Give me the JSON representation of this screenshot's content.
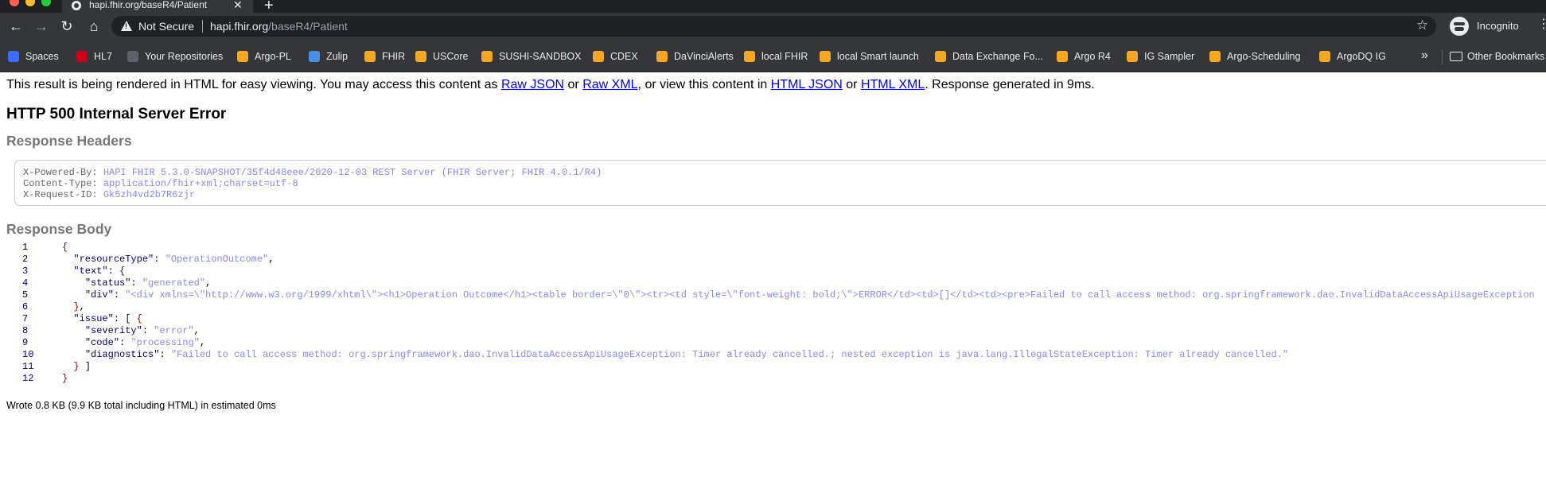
{
  "browser": {
    "tab_title": "hapi.fhir.org/baseR4/Patient",
    "tab_close": "✕",
    "new_tab": "+",
    "security_label": "Not Secure",
    "url_host": "hapi.fhir.org",
    "url_path": "/baseR4/Patient",
    "profile_label": "Incognito",
    "more_bookmarks": "»"
  },
  "bookmarks": [
    {
      "label": "Spaces",
      "icon": "spaces-icon",
      "color": "#3d6bff"
    },
    {
      "label": "HL7",
      "icon": "hl7-icon",
      "color": "#d0021b"
    },
    {
      "label": "Your Repositories",
      "icon": "github-icon",
      "color": "#5f6368"
    },
    {
      "label": "Argo-PL",
      "icon": "fhir-flame-icon",
      "color": "#f5a623"
    },
    {
      "label": "Zulip",
      "icon": "zulip-icon",
      "color": "#4a90e2"
    },
    {
      "label": "FHIR",
      "icon": "fhir-flame-icon",
      "color": "#f5a623"
    },
    {
      "label": "USCore",
      "icon": "fhir-flame-icon",
      "color": "#f5a623"
    },
    {
      "label": "SUSHI-SANDBOX",
      "icon": "fhir-flame-icon",
      "color": "#f5a623"
    },
    {
      "label": "CDEX",
      "icon": "fhir-flame-icon",
      "color": "#f5a623"
    },
    {
      "label": "DaVinciAlerts",
      "icon": "fhir-flame-icon",
      "color": "#f5a623"
    },
    {
      "label": "local FHIR",
      "icon": "fhir-flame-icon",
      "color": "#f5a623"
    },
    {
      "label": "local Smart launch",
      "icon": "fhir-flame-icon",
      "color": "#f5a623"
    },
    {
      "label": "Data Exchange Fo...",
      "icon": "fhir-flame-icon",
      "color": "#f5a623"
    },
    {
      "label": "Argo R4",
      "icon": "fhir-flame-icon",
      "color": "#f5a623"
    },
    {
      "label": "IG Sampler",
      "icon": "fhir-flame-icon",
      "color": "#f5a623"
    },
    {
      "label": "Argo-Scheduling",
      "icon": "fhir-flame-icon",
      "color": "#f5a623"
    },
    {
      "label": "ArgoDQ IG",
      "icon": "fhir-flame-icon",
      "color": "#f5a623"
    }
  ],
  "other_bookmarks": "Other Bookmarks",
  "page": {
    "intro_text_1": "This result is being rendered in HTML for easy viewing. You may access this content as ",
    "link_raw_json": "Raw JSON",
    "intro_or_1": " or ",
    "link_raw_xml": "Raw XML",
    "intro_text_2": ", or view this content in ",
    "link_html_json": "HTML JSON",
    "intro_or_2": " or ",
    "link_html_xml": "HTML XML",
    "intro_text_3": ". Response generated in 9ms.",
    "status_heading": "HTTP 500 Internal Server Error",
    "headers_heading": "Response Headers",
    "headers": [
      {
        "name": "X-Powered-By:",
        "value": "HAPI FHIR 5.3.0-SNAPSHOT/35f4d48eee/2020-12-03 REST Server (FHIR Server; FHIR 4.0.1/R4)"
      },
      {
        "name": "Content-Type:",
        "value": "application/fhir+xml;charset=utf-8"
      },
      {
        "name": "X-Request-ID:",
        "value": "Gk5zh4vd2b7R6zjr"
      }
    ],
    "body_heading": "Response Body",
    "footer": "Wrote 0.8 KB (9.9 KB total including HTML) in estimated 0ms"
  },
  "code_lines": [
    {
      "num": "1",
      "parts": [
        {
          "c": "brace",
          "t": "{"
        }
      ]
    },
    {
      "num": "2",
      "parts": [
        {
          "c": "plain",
          "t": "  "
        },
        {
          "c": "key",
          "t": "\"resourceType\""
        },
        {
          "c": "plain",
          "t": ": "
        },
        {
          "c": "str",
          "t": "\"OperationOutcome\""
        },
        {
          "c": "plain",
          "t": ","
        }
      ]
    },
    {
      "num": "3",
      "parts": [
        {
          "c": "plain",
          "t": "  "
        },
        {
          "c": "key",
          "t": "\"text\""
        },
        {
          "c": "plain",
          "t": ": "
        },
        {
          "c": "brace",
          "t": "{"
        }
      ]
    },
    {
      "num": "4",
      "parts": [
        {
          "c": "plain",
          "t": "    "
        },
        {
          "c": "key",
          "t": "\"status\""
        },
        {
          "c": "plain",
          "t": ": "
        },
        {
          "c": "str",
          "t": "\"generated\""
        },
        {
          "c": "plain",
          "t": ","
        }
      ]
    },
    {
      "num": "5",
      "parts": [
        {
          "c": "plain",
          "t": "    "
        },
        {
          "c": "key",
          "t": "\"div\""
        },
        {
          "c": "plain",
          "t": ": "
        },
        {
          "c": "str",
          "t": "\"<div xmlns=\\\"http://www.w3.org/1999/xhtml\\\"><h1>Operation Outcome</h1><table border=\\\"0\\\"><tr><td style=\\\"font-weight: bold;\\\">ERROR</td><td>[]</td><td><pre>Failed to call access method: org.springframework.dao.InvalidDataAccessApiUsageException"
        }
      ]
    },
    {
      "num": "6",
      "parts": [
        {
          "c": "plain",
          "t": "  "
        },
        {
          "c": "brace",
          "t": "}"
        },
        {
          "c": "plain",
          "t": ","
        }
      ]
    },
    {
      "num": "7",
      "parts": [
        {
          "c": "plain",
          "t": "  "
        },
        {
          "c": "key",
          "t": "\"issue\""
        },
        {
          "c": "plain",
          "t": ": [ "
        },
        {
          "c": "brace",
          "t": "{"
        }
      ]
    },
    {
      "num": "8",
      "parts": [
        {
          "c": "plain",
          "t": "    "
        },
        {
          "c": "key",
          "t": "\"severity\""
        },
        {
          "c": "plain",
          "t": ": "
        },
        {
          "c": "str",
          "t": "\"error\""
        },
        {
          "c": "plain",
          "t": ","
        }
      ]
    },
    {
      "num": "9",
      "parts": [
        {
          "c": "plain",
          "t": "    "
        },
        {
          "c": "key",
          "t": "\"code\""
        },
        {
          "c": "plain",
          "t": ": "
        },
        {
          "c": "str",
          "t": "\"processing\""
        },
        {
          "c": "plain",
          "t": ","
        }
      ]
    },
    {
      "num": "10",
      "parts": [
        {
          "c": "plain",
          "t": "    "
        },
        {
          "c": "key",
          "t": "\"diagnostics\""
        },
        {
          "c": "plain",
          "t": ": "
        },
        {
          "c": "str",
          "t": "\"Failed to call access method: org.springframework.dao.InvalidDataAccessApiUsageException: Timer already cancelled.; nested exception is java.lang.IllegalStateException: Timer already cancelled.\""
        }
      ]
    },
    {
      "num": "11",
      "parts": [
        {
          "c": "plain",
          "t": "  "
        },
        {
          "c": "brace",
          "t": "}"
        },
        {
          "c": "plain",
          "t": " ]"
        }
      ]
    },
    {
      "num": "12",
      "parts": [
        {
          "c": "brace",
          "t": "}"
        }
      ]
    }
  ]
}
